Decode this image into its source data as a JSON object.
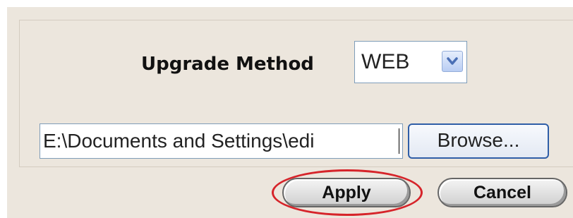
{
  "upgrade": {
    "method_label": "Upgrade Method",
    "method_value": "WEB",
    "file_path": "E:\\Documents and Settings\\edi",
    "browse_label": "Browse..."
  },
  "actions": {
    "apply_label": "Apply",
    "cancel_label": "Cancel"
  },
  "annotation": {
    "highlight_color": "#d6242a",
    "highlighted_control": "apply-button"
  },
  "icons": {
    "dropdown": "chevron-down-icon"
  },
  "colors": {
    "panel_bg": "#ece6dd",
    "browse_border": "#2f5ea7"
  }
}
